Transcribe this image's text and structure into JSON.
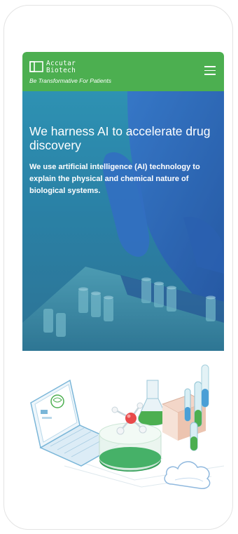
{
  "brand": {
    "name_line1": "Accutar",
    "name_line2": "Biotech",
    "tagline": "Be Transformative  For Patients"
  },
  "hero": {
    "title": "We harness AI to accelerate drug discovery",
    "description": "We use artificial intelligence (AI) technology to explain the physical and chemical nature of biological systems."
  },
  "colors": {
    "header_bg": "#4caf50",
    "hero_overlay": "#2a8bb0",
    "glove": "#2f5fbe"
  },
  "icons": {
    "logo": "square-bracket-logo-icon",
    "menu": "hamburger-menu-icon"
  }
}
